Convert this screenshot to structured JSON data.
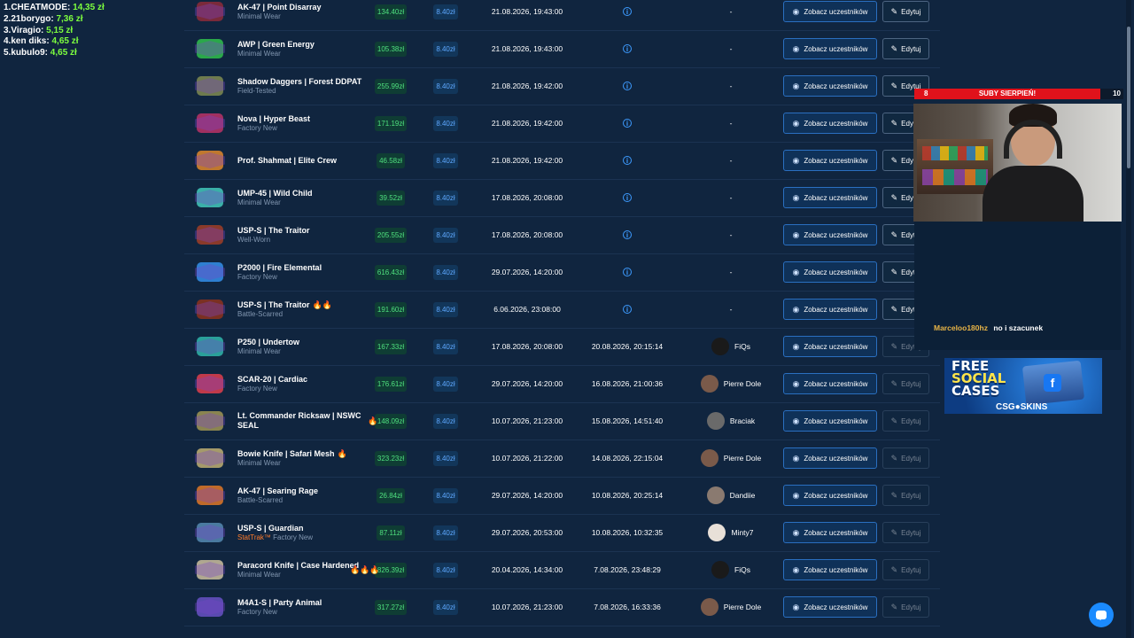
{
  "leaderboard": [
    {
      "name": "1.CHEATMODE:",
      "amount": "14,35 zł"
    },
    {
      "name": "2.21borygo:",
      "amount": "7,36 zł"
    },
    {
      "name": "3.Viragio:",
      "amount": "5,15 zł"
    },
    {
      "name": "4.ken diks:",
      "amount": "4,65 zł"
    },
    {
      "name": "5.kubulo9:",
      "amount": "4,65 zł"
    }
  ],
  "table": {
    "rows": [
      {
        "name": "AK-47 | Point Disarray",
        "cond": "Minimal Wear",
        "price": "134.40zł",
        "entry": "8.40zł",
        "start": "21.08.2026, 19:43:00",
        "end_info": true,
        "winner": "-",
        "view": "Zobacz uczestników",
        "edit": "Edytuj",
        "img": "#7a2a3a"
      },
      {
        "name": "AWP | Green Energy",
        "cond": "Minimal Wear",
        "price": "105.38zł",
        "entry": "8.40zł",
        "start": "21.08.2026, 19:43:00",
        "end_info": true,
        "winner": "-",
        "view": "Zobacz uczestników",
        "edit": "Edytuj",
        "img": "#2aa84a"
      },
      {
        "name": "Shadow Daggers | Forest DDPAT",
        "cond": "Field-Tested",
        "price": "255.99zł",
        "entry": "8.40zł",
        "start": "21.08.2026, 19:42:00",
        "end_info": true,
        "winner": "-",
        "view": "Zobacz uczestników",
        "edit": "Edytuj",
        "img": "#6e7b4e"
      },
      {
        "name": "Nova | Hyper Beast",
        "cond": "Factory New",
        "price": "171.19zł",
        "entry": "8.40zł",
        "start": "21.08.2026, 19:42:00",
        "end_info": true,
        "winner": "-",
        "view": "Zobacz uczestników",
        "edit": "Edytuj",
        "img": "#a03060"
      },
      {
        "name": "Prof. Shahmat | Elite Crew",
        "cond": "",
        "price": "46.58zł",
        "entry": "8.40zł",
        "start": "21.08.2026, 19:42:00",
        "end_info": true,
        "winner": "-",
        "view": "Zobacz uczestników",
        "edit": "Edytuj",
        "img": "#c0782e"
      },
      {
        "name": "UMP-45 | Wild Child",
        "cond": "Minimal Wear",
        "price": "39.52zł",
        "entry": "8.40zł",
        "start": "17.08.2026, 20:08:00",
        "end_info": true,
        "winner": "-",
        "view": "Zobacz uczestników",
        "edit": "Edytuj",
        "img": "#3ab0a8"
      },
      {
        "name": "USP-S | The Traitor",
        "cond": "Well-Worn",
        "price": "205.55zł",
        "entry": "8.40zł",
        "start": "17.08.2026, 20:08:00",
        "end_info": true,
        "winner": "-",
        "view": "Zobacz uczestników",
        "edit": "Edytuj",
        "img": "#8a3a2a"
      },
      {
        "name": "P2000 | Fire Elemental",
        "cond": "Factory New",
        "price": "616.43zł",
        "entry": "8.40zł",
        "start": "29.07.2026, 14:20:00",
        "end_info": true,
        "winner": "-",
        "view": "Zobacz uczestników",
        "edit": "Edytuj",
        "img": "#2e7fd0"
      },
      {
        "name": "USP-S | The Traitor",
        "cond": "Battle-Scarred",
        "fire": "🔥🔥",
        "price": "191.60zł",
        "entry": "8.40zł",
        "start": "6.06.2026, 23:08:00",
        "end_info": true,
        "winner": "-",
        "view": "Zobacz uczestników",
        "edit": "Edytuj",
        "img": "#7a3022"
      },
      {
        "name": "P250 | Undertow",
        "cond": "Minimal Wear",
        "price": "167.33zł",
        "entry": "8.40zł",
        "start": "17.08.2026, 20:08:00",
        "end": "20.08.2026, 20:15:14",
        "winner": "FiQs",
        "view": "Zobacz uczestników",
        "edit": "Edytuj",
        "edit_disabled": true,
        "img": "#2aa09a",
        "avatar": "#1a1a1a"
      },
      {
        "name": "SCAR-20 | Cardiac",
        "cond": "Factory New",
        "price": "176.61zł",
        "entry": "8.40zł",
        "start": "29.07.2026, 14:20:00",
        "end": "16.08.2026, 21:00:36",
        "winner": "Pierre Dole",
        "view": "Zobacz uczestników",
        "edit": "Edytuj",
        "edit_disabled": true,
        "img": "#c03a4a",
        "avatar": "#7a5a4a"
      },
      {
        "name": "Lt. Commander Ricksaw | NSWC SEAL",
        "cond": "",
        "fire_price": "🔥",
        "price": "148.09zł",
        "entry": "8.40zł",
        "start": "10.07.2026, 21:23:00",
        "end": "15.08.2026, 14:51:40",
        "winner": "Braciak",
        "view": "Zobacz uczestników",
        "edit": "Edytuj",
        "edit_disabled": true,
        "img": "#8a8450",
        "avatar": "#6a6a6a"
      },
      {
        "name": "Bowie Knife | Safari Mesh",
        "cond": "Minimal Wear",
        "fire": "🔥",
        "price": "323.23zł",
        "entry": "8.40zł",
        "start": "10.07.2026, 21:22:00",
        "end": "14.08.2026, 22:15:04",
        "winner": "Pierre Dole",
        "view": "Zobacz uczestników",
        "edit": "Edytuj",
        "edit_disabled": true,
        "img": "#a59a6a",
        "avatar": "#7a5a4a"
      },
      {
        "name": "AK-47 | Searing Rage",
        "cond": "Battle-Scarred",
        "price": "26.84zł",
        "entry": "8.40zł",
        "start": "29.07.2026, 14:20:00",
        "end": "10.08.2026, 20:25:14",
        "winner": "Dandiie",
        "view": "Zobacz uczestników",
        "edit": "Edytuj",
        "edit_disabled": true,
        "img": "#c06a2a",
        "avatar": "#8a7a70"
      },
      {
        "name": "USP-S | Guardian",
        "cond_st": "StatTrak™",
        "cond": "Factory New",
        "price": "87.11zł",
        "entry": "8.40zł",
        "start": "29.07.2026, 20:53:00",
        "end": "10.08.2026, 10:32:35",
        "winner": "Minty7",
        "view": "Zobacz uczestników",
        "edit": "Edytuj",
        "edit_disabled": true,
        "img": "#4a7aa0",
        "avatar": "#e8e0d8"
      },
      {
        "name": "Paracord Knife | Case Hardened",
        "cond": "Minimal Wear",
        "fire_price": "🔥🔥🔥",
        "price": "826.39zł",
        "entry": "8.40zł",
        "start": "20.04.2026, 14:34:00",
        "end": "7.08.2026, 23:48:29",
        "winner": "FiQs",
        "view": "Zobacz uczestników",
        "edit": "Edytuj",
        "edit_disabled": true,
        "img": "#b0a890",
        "avatar": "#1a1a1a"
      },
      {
        "name": "M4A1-S | Party Animal",
        "cond": "Factory New",
        "price": "317.27zł",
        "entry": "8.40zł",
        "start": "10.07.2026, 21:23:00",
        "end": "7.08.2026, 16:33:36",
        "winner": "Pierre Dole",
        "view": "Zobacz uczestników",
        "edit": "Edytuj",
        "edit_disabled": true,
        "img": "#5a4ab0",
        "avatar": "#7a5a4a"
      }
    ]
  },
  "subbar": {
    "left": "8",
    "label": "SUBY SIERPIEŃ!",
    "right": "10"
  },
  "chat": {
    "user": "Marceloo180hz",
    "text": "no i szacunek"
  },
  "promo": {
    "line1": "FREE",
    "line2": "SOCIAL",
    "line3": "CASES",
    "brand": "CSG●SKINS"
  }
}
